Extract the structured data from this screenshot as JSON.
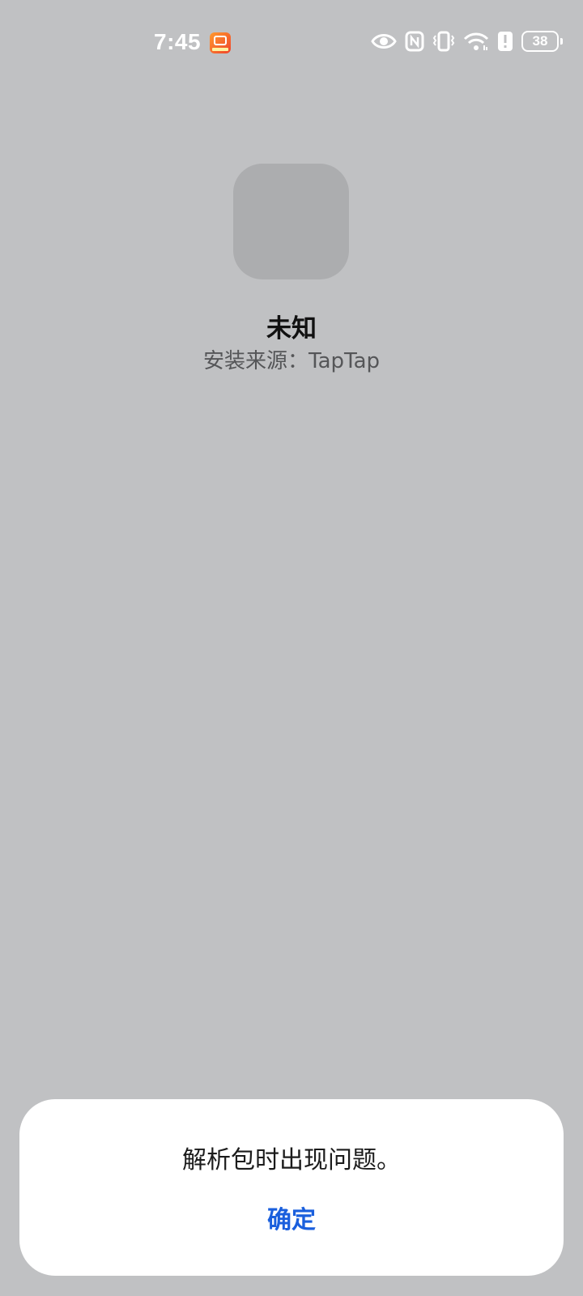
{
  "status_bar": {
    "time": "7:45",
    "notification_icon": "red-app-icon",
    "icons": [
      "eye-icon",
      "nfc-icon",
      "vibrate-icon",
      "wifi-icon",
      "alert-icon"
    ],
    "battery_level": "38"
  },
  "app": {
    "name": "未知",
    "install_source": "安装来源：TapTap"
  },
  "dialog": {
    "message": "解析包时出现问题。",
    "confirm_label": "确定",
    "accent_color": "#1a5fdd"
  }
}
